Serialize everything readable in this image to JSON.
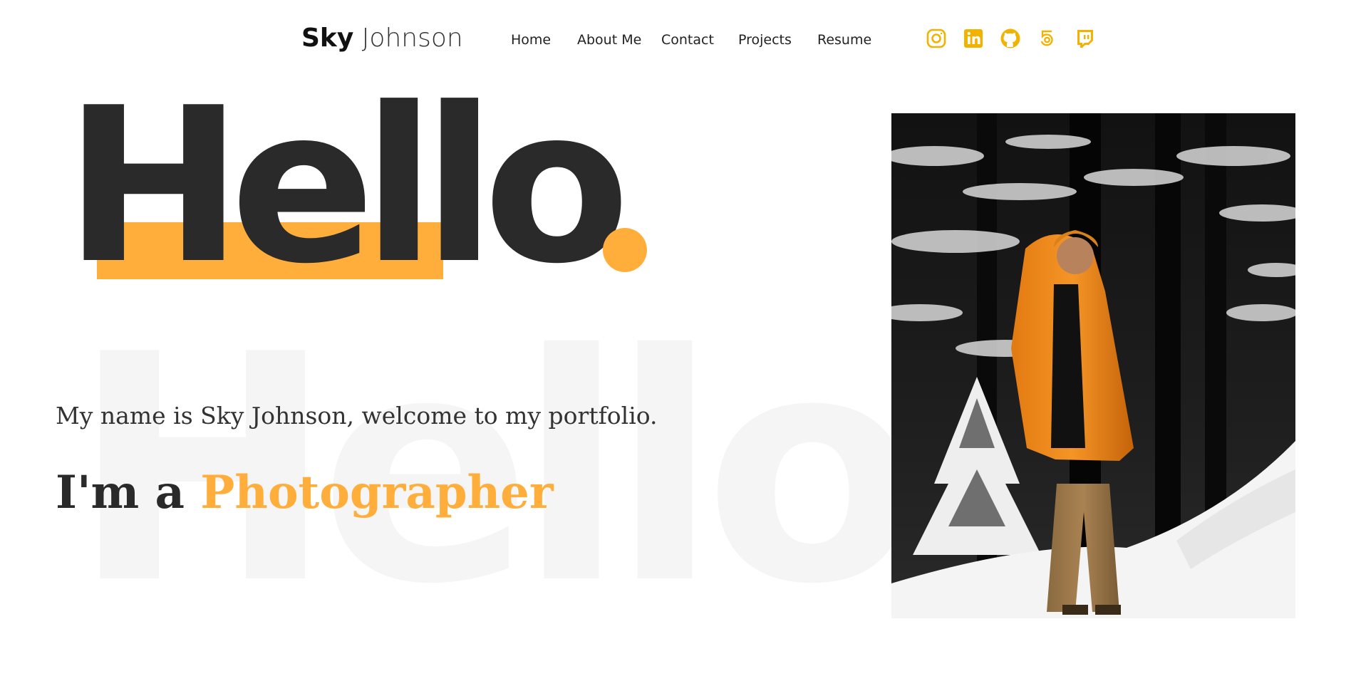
{
  "logo": {
    "first": "Sky",
    "last": "Johnson"
  },
  "nav": [
    {
      "label": "Home"
    },
    {
      "label": "About Me"
    },
    {
      "label": "Contact"
    },
    {
      "label": "Projects"
    },
    {
      "label": "Resume"
    }
  ],
  "socials": [
    {
      "icon": "instagram-icon"
    },
    {
      "icon": "linkedin-icon"
    },
    {
      "icon": "github-icon"
    },
    {
      "icon": "500px-icon"
    },
    {
      "icon": "twitch-icon"
    }
  ],
  "hero": {
    "hello": "Hello",
    "watermark": "Hello",
    "intro": "My name is Sky Johnson, welcome to my portfolio.",
    "role_prefix": "I'm a",
    "role_accent": "Photographer"
  },
  "colors": {
    "accent": "#ffae3b",
    "text": "#2a2a2a",
    "icon": "#f2b200"
  }
}
